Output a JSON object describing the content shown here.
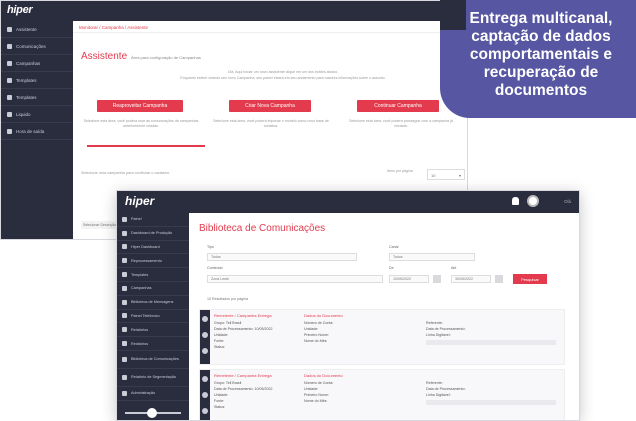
{
  "promo": {
    "text": "Entrega multicanal, captação de dados comportamentais e recuperação de documentos"
  },
  "window_back": {
    "logo": "hiper",
    "sidebar": [
      "Assistente",
      "Comunicações",
      "Campanhas",
      "Templates",
      "Templates",
      "Liquido",
      "Hora de saída"
    ],
    "breadcrumb": "Monitorar / Campanha / Assistente",
    "title": "Assistente",
    "subtitle": "Área para configuração de Campanhas",
    "info_line1": "Olá, Aqui iniciar um novo assistente clique em um dos botões abaixo.",
    "info_line2": "Enquanto estiver criando seu novo Campanha, seu painel estará em seu andamento para maiores informações sobre o assunto.",
    "buttons": [
      {
        "label": "Reaproveitar Campanha",
        "desc": "Selecione esta área, você poderá usar as comunicações de campanhas anteriormente criadas."
      },
      {
        "label": "Criar Nova Campanha",
        "desc": "Selecione esta área, você poderá importar o modelo como novo base de contatos."
      },
      {
        "label": "Continuar Campanha",
        "desc": "Selecione esta área, você poderá prosseguir com a campanha já iniciada."
      }
    ],
    "hint": "Selecione uma campanha para continuar o cadastro.",
    "pagination_label": "Itens por página",
    "pagination_value": "10",
    "table_header": "Selecionar   Descrição"
  },
  "window_front": {
    "logo": "hiper",
    "user": "Olá",
    "sidebar": [
      "Painel",
      "Dashboard de Produção",
      "Hiper Dashboard",
      "Reprocessamento",
      "Templates",
      "Campanhas",
      "Biblioteca de Mensagens",
      "Painel Telefonico",
      "Relatórios",
      "Relatórios",
      "Biblioteca de Comunicações",
      "Relatório de Segmentação",
      "Administração"
    ],
    "title": "Biblioteca de Comunicações",
    "filters": {
      "tipo_label": "Tipo",
      "tipo_value": "Todos",
      "canal_label": "Canal",
      "canal_value": "Todos",
      "conteudo_label": "Conteúdo",
      "conteudo_value": "Zona Leste",
      "de_label": "De",
      "de_value": "10/05/2022",
      "ate_label": "Até",
      "ate_value": "30/05/2022",
      "search_label": "Pesquisar"
    },
    "per_page": "10 Resultados por página",
    "cards": [
      {
        "head1": "Remetente / Campanha Entrega",
        "head2": "Dados do Documento",
        "fields1": [
          "Grupo: Tell Brasil",
          "Data de Processamento: 10/05/2022",
          "Unidade:",
          "Fonte:",
          "Status:"
        ],
        "fields2": [
          "Número de Conta:",
          "Unidade:",
          "Primeiro Nome:",
          "Nome do Mês:"
        ],
        "fields3": [
          "Referente:",
          "Data de Processamento:",
          "Linha Digitável:"
        ]
      },
      {
        "head1": "Remetente / Campanha Entrega",
        "head2": "Dados do Documento",
        "fields1": [
          "Grupo: Tell Brasil",
          "Data de Processamento: 10/05/2022",
          "Unidade:",
          "Fonte:",
          "Status:"
        ],
        "fields2": [
          "Número de Conta:",
          "Unidade:",
          "Primeiro Nome:",
          "Nome do Mês:"
        ],
        "fields3": [
          "Referente:",
          "Data de Processamento:",
          "Linha Digitável:"
        ]
      }
    ]
  }
}
